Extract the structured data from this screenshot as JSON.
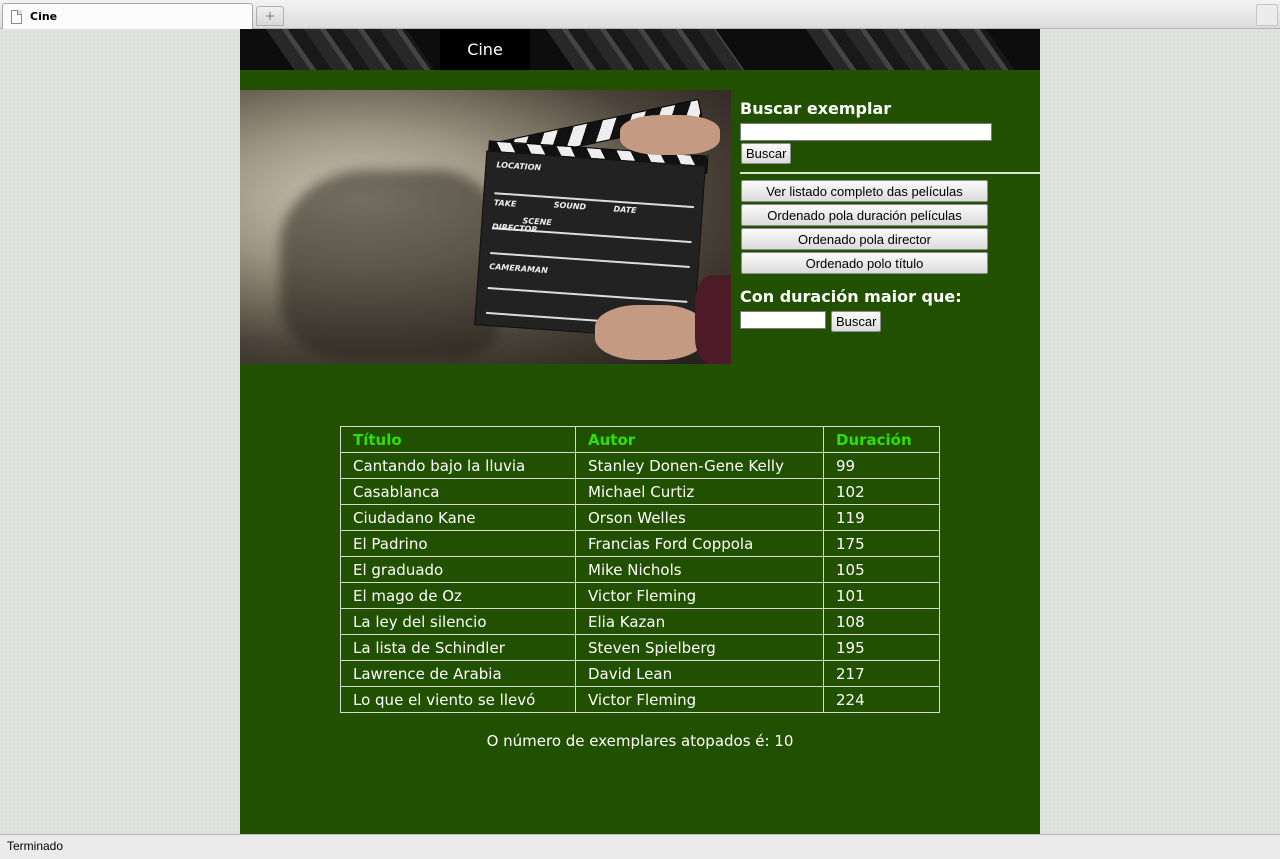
{
  "browser": {
    "tab_title": "Cine",
    "new_tab_label": "+",
    "status_text": "Terminado"
  },
  "header": {
    "title": "Cine"
  },
  "search": {
    "heading": "Buscar exemplar",
    "value": "",
    "button_label": "Buscar"
  },
  "list_buttons": [
    "Ver listado completo das películas",
    "Ordenado pola duración películas",
    "Ordenado pola director",
    "Ordenado polo título"
  ],
  "duration": {
    "heading": "Con duración maior que:",
    "value": "",
    "button_label": "Buscar"
  },
  "table": {
    "headers": [
      "Título",
      "Autor",
      "Duración"
    ],
    "rows": [
      [
        "Cantando bajo la lluvia",
        "Stanley Donen-Gene Kelly",
        "99"
      ],
      [
        "Casablanca",
        "Michael Curtiz",
        "102"
      ],
      [
        "Ciudadano Kane",
        "Orson Welles",
        "119"
      ],
      [
        "El Padrino",
        "Francias Ford Coppola",
        "175"
      ],
      [
        "El graduado",
        "Mike Nichols",
        "105"
      ],
      [
        "El mago de Oz",
        "Victor Fleming",
        "101"
      ],
      [
        "La ley del silencio",
        "Elia Kazan",
        "108"
      ],
      [
        "La lista de Schindler",
        "Steven Spielberg",
        "195"
      ],
      [
        "Lawrence de Arabia",
        "David Lean",
        "217"
      ],
      [
        "Lo que el viento se llevó",
        "Victor Fleming",
        "224"
      ]
    ]
  },
  "count_text": "O número de exemplares atopados é: 10",
  "clapperboard_text": {
    "location": "LOCATION",
    "take": "TAKE",
    "scene": "SCENE",
    "sound": "SOUND",
    "date": "DATE",
    "director": "DIRECTOR",
    "cameraman": "CAMERAMAN"
  },
  "colors": {
    "page_green": "#215100",
    "table_header": "#2fe000"
  }
}
